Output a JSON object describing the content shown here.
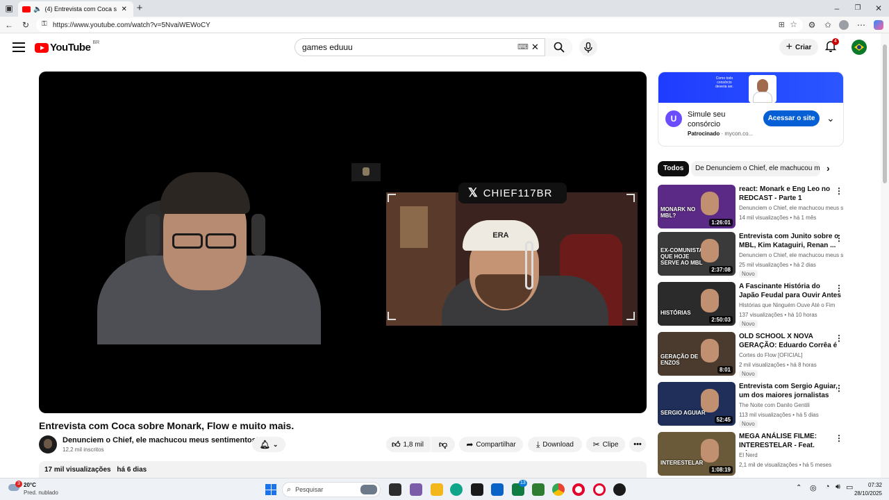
{
  "browser": {
    "tab_title": "(4) Entrevista com Coca sobre...",
    "url": "https://www.youtube.com/watch?v=5NvaiWEWoCY"
  },
  "header": {
    "logo_text": "YouTube",
    "region": "BR",
    "search_value": "games eduuu",
    "create_label": "Criar",
    "notifications_count": "4"
  },
  "player": {
    "overlay_handle": "CHIEF117BR",
    "cap_text": "ERA"
  },
  "video": {
    "title": "Entrevista com Coca sobre Monark, Flow e muito mais.",
    "channel": "Denunciem o Chief, ele machucou meus sentimentos!",
    "subscribers": "12,2 mil inscritos",
    "likes": "1,8 mil",
    "share_label": "Compartilhar",
    "download_label": "Download",
    "clip_label": "Clipe",
    "views": "17 mil visualizações",
    "age": "há 6 dias"
  },
  "ad": {
    "banner_text": "Como todo consórcio deveria ser.",
    "title": "Simule seu consórcio",
    "sponsored": "Patrocinado",
    "domain": "mycon.co...",
    "cta": "Acessar o site"
  },
  "chips": [
    "Todos",
    "De Denunciem o Chief, ele machucou meus sentimentos!"
  ],
  "recommendations": [
    {
      "title": "react: Monark e Eng Leo no REDCAST - Parte 1",
      "channel": "Denunciem o Chief, ele machucou meus sentimentos!",
      "views": "14 mil visualizações",
      "age": "há 1 mês",
      "duration": "1:26:01",
      "badge": "",
      "thumb_text": "MONARK NO MBL?",
      "thumb_color": "#5b2a86"
    },
    {
      "title": "Entrevista com Junito sobre o MBL, Kim Kataguiri, Renan ...",
      "channel": "Denunciem o Chief, ele machucou meus sentimentos!",
      "views": "25 mil visualizações",
      "age": "há 2 dias",
      "duration": "2:37:08",
      "badge": "Novo",
      "thumb_text": "EX-COMUNISTA QUE HOJE SERVE AO MBL",
      "thumb_color": "#3a3a3a"
    },
    {
      "title": "A Fascinante História do Japão Feudal para Ouvir Antes de ...",
      "channel": "Histórias que Ninguém Ouve Até o Fim",
      "views": "137 visualizações",
      "age": "há 10 horas",
      "duration": "2:50:03",
      "badge": "Novo",
      "thumb_text": "HISTÓRIAS",
      "thumb_color": "#2b2b2b"
    },
    {
      "title": "OLD SCHOOL X NOVA GERAÇÃO: Eduardo Corrêa é ...",
      "channel": "Cortes do Flow [OFICIAL]",
      "views": "2 mil visualizações",
      "age": "há 8 horas",
      "duration": "8:01",
      "badge": "Novo",
      "thumb_text": "GERAÇÃO DE ENZOS",
      "thumb_color": "#4a3b2e"
    },
    {
      "title": "Entrevista com Sergio Aguiar, um dos maiores jornalistas do...",
      "channel": "The Noite com Danilo Gentili",
      "views": "113 mil visualizações",
      "age": "há 5 dias",
      "duration": "52:45",
      "badge": "Novo",
      "thumb_text": "SERGIO AGUIAR",
      "thumb_color": "#1f2f5a"
    },
    {
      "title": "MEGA ANÁLISE FILME: INTERESTELAR - Feat. SÉRGI...",
      "channel": "El Nerd",
      "views": "2,1 mil de visualizações",
      "age": "há 5 meses",
      "duration": "1:08:19",
      "badge": "",
      "thumb_text": "INTERESTELAR",
      "thumb_color": "#6a5a3a"
    }
  ],
  "taskbar": {
    "weather_temp": "20°C",
    "weather_desc": "Pred. nublado",
    "weather_badge": "3",
    "search_placeholder": "Pesquisar",
    "time": "07:32",
    "date": "28/10/2025"
  }
}
